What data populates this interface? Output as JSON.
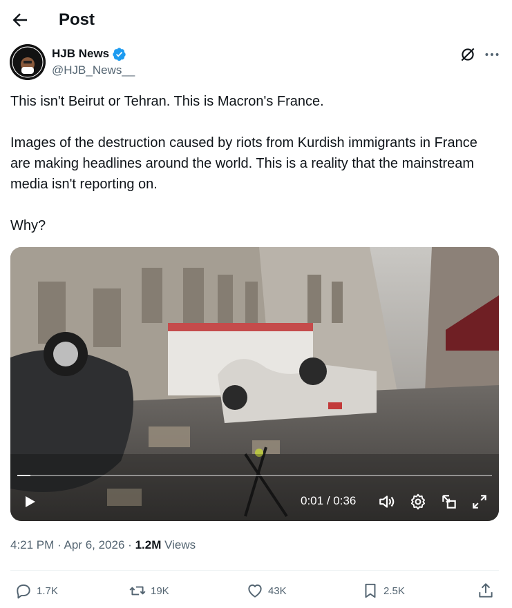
{
  "header": {
    "back_icon": "arrow-left-icon",
    "title": "Post"
  },
  "author": {
    "name": "HJB News",
    "handle": "@HJB_News__",
    "verified_color": "#1d9bf0",
    "avatar_text_top": "HJB NEWS",
    "avatar_text_bottom": "KEEPING IT REAL"
  },
  "post": {
    "text": "This isn't Beirut or Tehran. This is Macron's France.\n\nImages of the destruction caused by riots from Kurdish immigrants in France are making headlines around the world. This is a reality that the mainstream media isn't reporting on.\n\nWhy?"
  },
  "video": {
    "current_time": "0:01",
    "separator": " / ",
    "duration": "0:36",
    "progress": 0.028
  },
  "meta": {
    "time": "4:21 PM",
    "date": "Apr 6, 2026",
    "views_count": "1.2M",
    "views_label": "Views"
  },
  "actions": {
    "replies": "1.7K",
    "reposts": "19K",
    "likes": "43K",
    "bookmarks": "2.5K"
  }
}
